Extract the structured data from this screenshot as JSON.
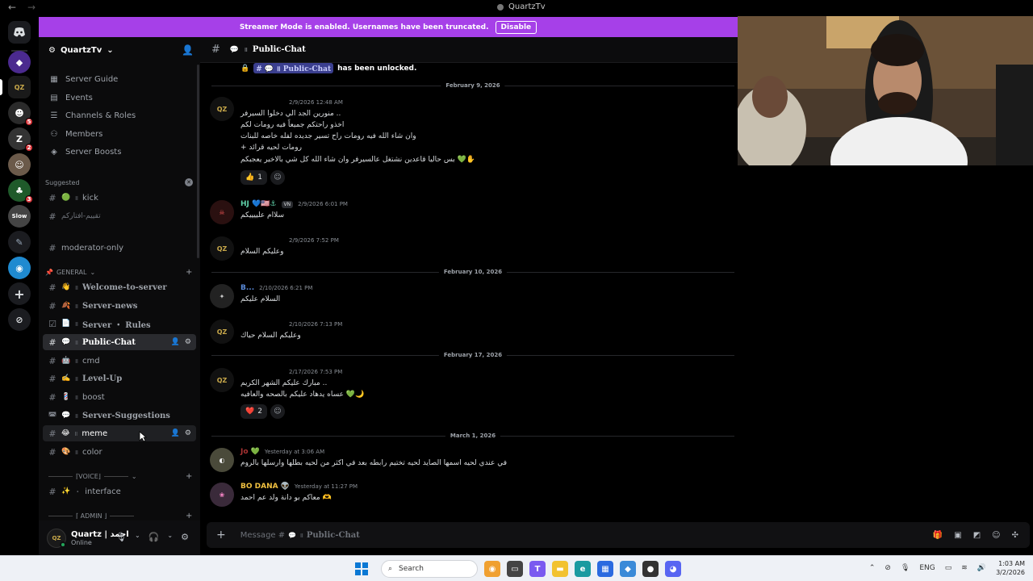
{
  "window": {
    "title": "QuartzTv",
    "back": "←",
    "forward": "→"
  },
  "banner": {
    "text": "Streamer Mode is enabled. Usernames have been truncated.",
    "button": "Disable"
  },
  "server": {
    "name": "QuartzTv"
  },
  "nav": [
    {
      "label": "Server Guide",
      "icon": "compass-icon"
    },
    {
      "label": "Events",
      "icon": "calendar-icon"
    },
    {
      "label": "Channels & Roles",
      "icon": "list-icon"
    },
    {
      "label": "Members",
      "icon": "members-icon"
    },
    {
      "label": "Server Boosts",
      "icon": "boost-icon"
    }
  ],
  "suggested": {
    "label": "Suggested",
    "channels": [
      {
        "emoji": "🟢",
        "name": "kick"
      },
      {
        "emoji": "",
        "name": "تقييم-افتاركم"
      }
    ]
  },
  "moderator": {
    "name": "moderator-only"
  },
  "categories": {
    "general": "GENERAL",
    "voice": "⌈VOICE⌋",
    "admin": "⌈ ADMIN ⌋"
  },
  "channels": [
    {
      "emoji": "👋",
      "name": "Welcome-to-server",
      "styled": true
    },
    {
      "emoji": "🍂",
      "name": "Server-news",
      "styled": true
    },
    {
      "emoji": "📄",
      "name": "Server ・ Rules",
      "styled": true
    },
    {
      "emoji": "💬",
      "name": "Public-Chat",
      "styled": true,
      "active": true
    },
    {
      "emoji": "🤖",
      "name": "cmd",
      "styled": false
    },
    {
      "emoji": "✍️",
      "name": "Level-Up",
      "styled": true
    },
    {
      "emoji": "💈",
      "name": "boost",
      "styled": false
    },
    {
      "emoji": "💬",
      "name": "Server-Suggestions",
      "styled": true
    },
    {
      "emoji": "😂",
      "name": "meme",
      "styled": false,
      "hover": true
    },
    {
      "emoji": "🎨",
      "name": "color",
      "styled": false
    }
  ],
  "voice_channels": [
    {
      "emoji": "✨",
      "name": "interface"
    }
  ],
  "separator": "॥",
  "user": {
    "name": "Quartz | احمد",
    "status": "Online",
    "avatar": "QZ"
  },
  "chat": {
    "channel": "Public-Chat",
    "unlock_text": "has been unlocked.",
    "placeholder_prefix": "Message #",
    "dividers": [
      "February 9, 2026",
      "February 10, 2026",
      "February 17, 2026",
      "March 1, 2026"
    ],
    "messages": [
      {
        "author": "",
        "time": "2/9/2026 12:48 AM",
        "lines": [
          "منورين الجد الي دخلوا السيرفر ..",
          "اخذو راحتكم جميعاً فيه رومات لكم",
          "وان شاء الله فيه رومات راح تسير جديده لفله خاصه للبنات",
          "+ رومات لحيه قرائد",
          "بس حاليا قاعدين نشتغل عالسيرفر وان شاء الله كل شي بالاخير يعجبكم 💚✋"
        ],
        "reaction": {
          "emoji": "👍",
          "count": "1"
        }
      },
      {
        "author": "HJ 💙🇺🇸⚓",
        "tag": "VN",
        "time": "2/9/2026 6:01 PM",
        "lines": [
          "سلاام علييييكم"
        ]
      },
      {
        "author": "",
        "time": "2/9/2026 7:52 PM",
        "lines": [
          "وعليكم السلام"
        ]
      },
      {
        "author": "B...",
        "time": "2/10/2026 6:21 PM",
        "lines": [
          "السلام عليكم"
        ]
      },
      {
        "author": "",
        "time": "2/10/2026 7:13 PM",
        "lines": [
          "وعليكم السلام حياك"
        ]
      },
      {
        "author": "",
        "time": "2/17/2026 7:53 PM",
        "lines": [
          "مبارك عليكم الشهر الكريم ..",
          "عساه يدهاد عليكم بالصحه والعافيه 💚🌙"
        ],
        "reaction": {
          "emoji": "❤️",
          "count": "2"
        }
      },
      {
        "author": "Jo 💚",
        "time": "Yesterday at 3:06 AM",
        "lines": [
          "في عندي لحيه اسمها الصايد لحيه تختيم رابطه بعد في اكثر من لحيه بطلها وارسلها بالروم"
        ]
      },
      {
        "author": "BO DANA 👽",
        "time": "Yesterday at 11:27 PM",
        "lines": [
          "معاكم بو دانة ولد عم احمد 🫶"
        ]
      }
    ]
  },
  "taskbar": {
    "search": "Search",
    "lang": "ENG",
    "time": "1:03 AM",
    "date": "3/2/2026"
  },
  "colors": {
    "banner": "#a640e8",
    "accent": "#5865f2",
    "online": "#23a55a"
  }
}
